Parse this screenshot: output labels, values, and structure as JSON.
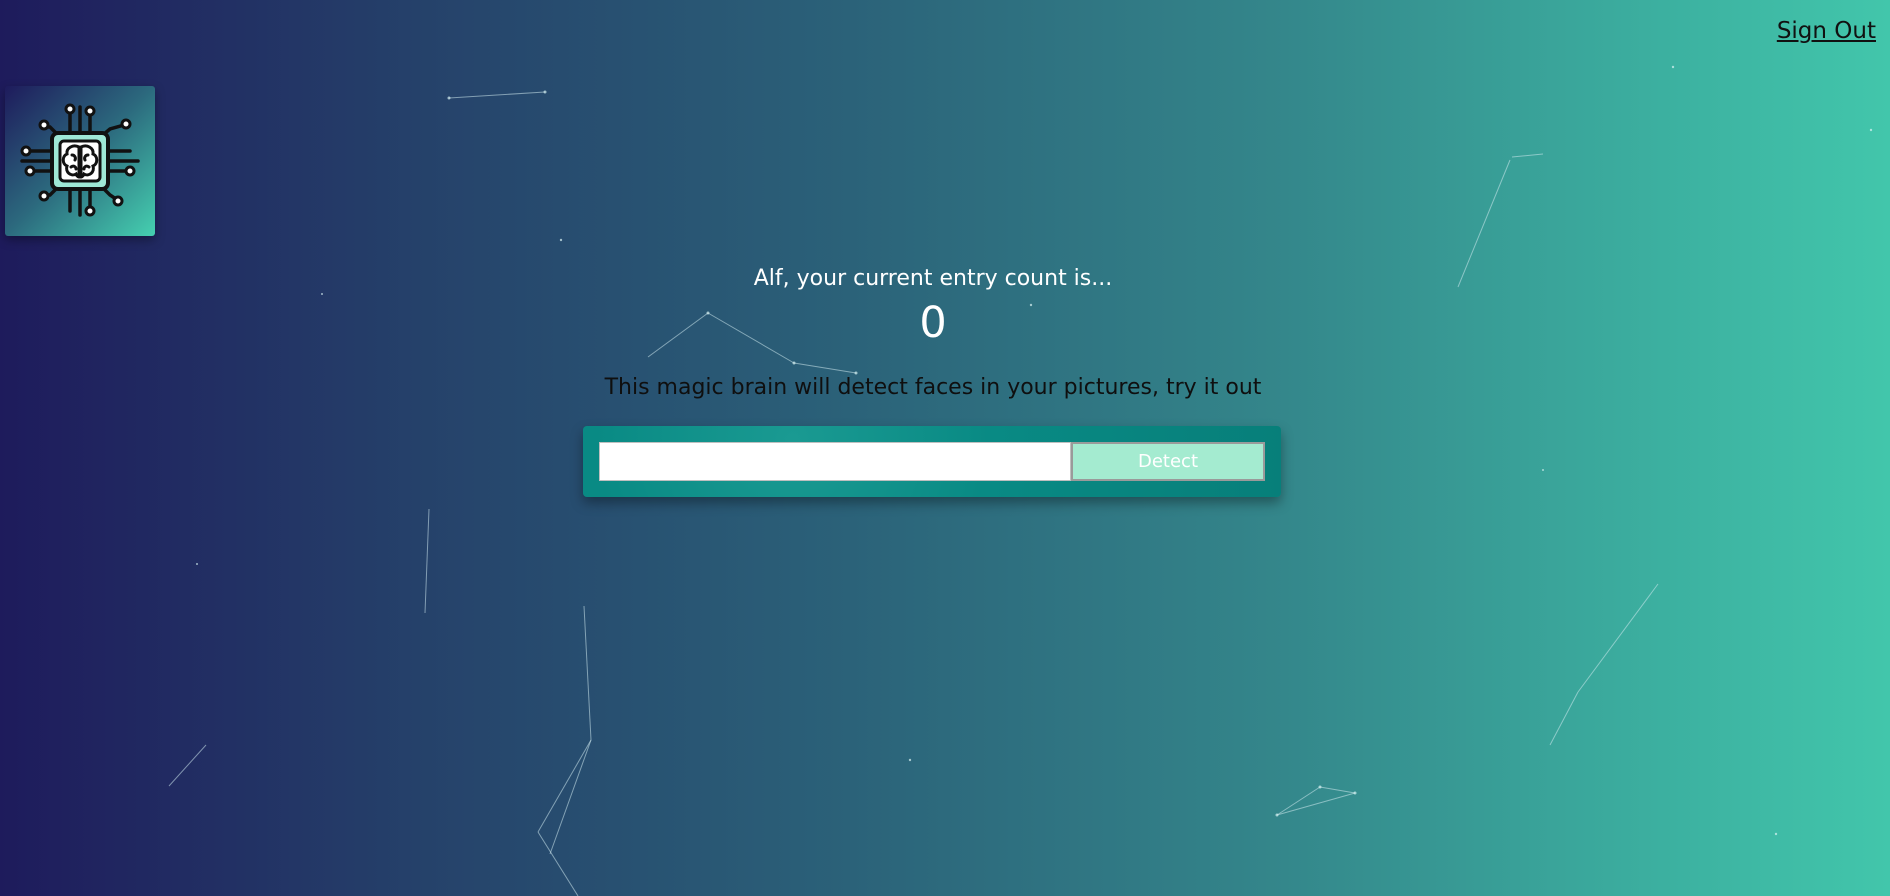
{
  "header": {
    "sign_out_label": "Sign Out"
  },
  "logo": {
    "icon": "brain-chip-icon"
  },
  "rank": {
    "message": "Alf, your current entry count is...",
    "count": "0"
  },
  "detector": {
    "tagline": "This magic brain will detect faces in your pictures, try it out",
    "input_value": "",
    "button_label": "Detect"
  },
  "colors": {
    "background_start": "#1e1b5c",
    "background_end": "#42c6ab",
    "panel": "#098a84",
    "button": "#a4ebd0"
  }
}
